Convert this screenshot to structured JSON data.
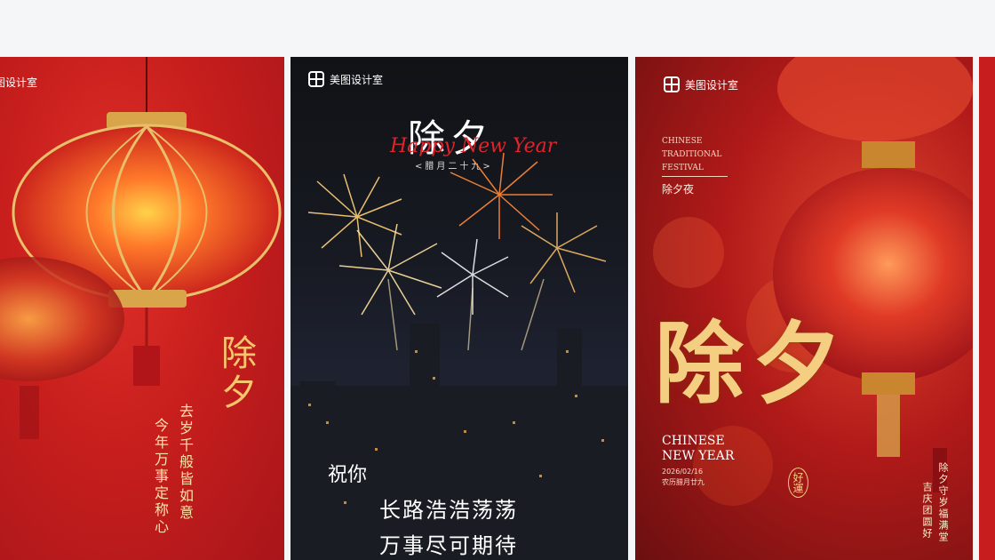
{
  "brand": {
    "name": "美图设计室",
    "partial": "图设计室"
  },
  "cards": [
    {
      "title": "除夕",
      "lines": [
        "去岁千般皆如意",
        "今年万事定称心"
      ]
    },
    {
      "title": "除夕",
      "subtitle": "Happy New Year",
      "date": "<腊月二十九>",
      "blessing": [
        "祝你",
        "长路浩浩荡荡",
        "万事尽可期待"
      ]
    },
    {
      "label": [
        "CHINESE",
        "TRADITIONAL",
        "FESTIVAL"
      ],
      "tag": "除夕夜",
      "title": "除夕",
      "en_title": [
        "CHINESE",
        "NEW YEAR"
      ],
      "date": "2026/02/16",
      "lunar": "农历腊月廿九",
      "seal": "好運",
      "side": [
        "除夕守岁福满堂",
        "吉庆团圆好"
      ]
    }
  ]
}
